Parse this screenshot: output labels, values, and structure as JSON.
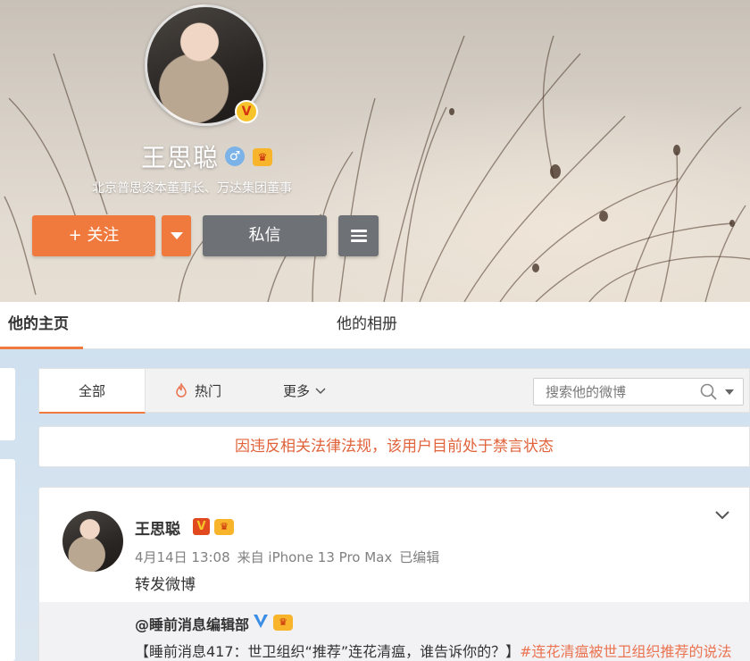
{
  "profile": {
    "name": "王思聪",
    "description": "北京普思资本董事长、万达集团董事",
    "verified_badge": "V",
    "gender_symbol": "♂",
    "crown_symbol": "♛"
  },
  "actions": {
    "follow_label": "+ 关注",
    "message_label": "私信"
  },
  "profile_tabs": [
    {
      "label": "他的主页",
      "active": true
    },
    {
      "label": "他的相册",
      "active": false
    }
  ],
  "filters": {
    "all_label": "全部",
    "hot_label": "热门",
    "more_label": "更多",
    "search_placeholder": "搜索他的微博"
  },
  "notice": "因违反相关法律法规，该用户目前处于禁言状态",
  "post": {
    "author": "王思聪",
    "time": "4月14日 13:08",
    "source": "来自 iPhone 13 Pro Max",
    "edited": "已编辑",
    "text": "转发微博",
    "repost": {
      "author": "@睡前消息编辑部",
      "text": "【睡前消息417：世卫组织“推荐”连花清瘟，谁告诉你的？】",
      "tag": "#连花清瘟被世卫组织推荐的说法"
    }
  },
  "colors": {
    "accent": "#f07a3e",
    "notice_text": "#e0633b",
    "button_dark": "#6e7176",
    "link": "#eb7350"
  },
  "icons": [
    "gender-male-icon",
    "crown-icon",
    "verified-icon",
    "caret-down-icon",
    "menu-icon",
    "fire-icon",
    "chevron-down-icon",
    "search-icon"
  ]
}
